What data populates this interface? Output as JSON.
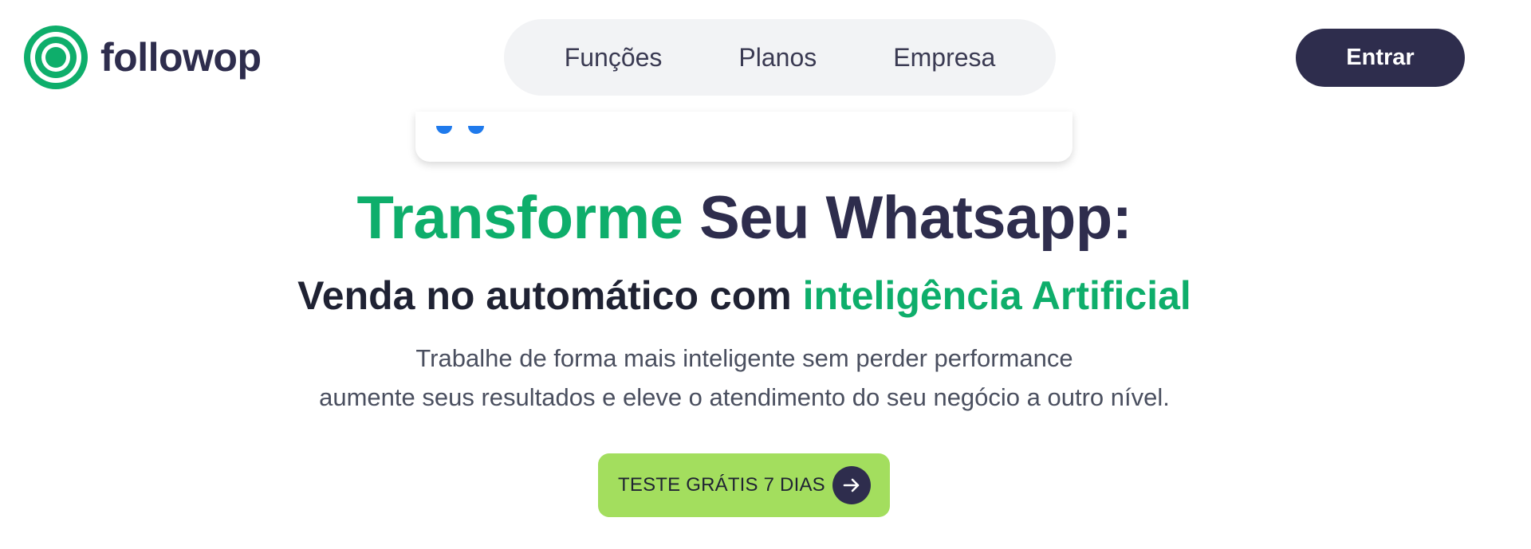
{
  "brand": {
    "name": "followop",
    "logo_icon": "concentric-circles-icon",
    "color": "#0eae6b"
  },
  "nav": {
    "items": [
      {
        "label": "Funções"
      },
      {
        "label": "Planos"
      },
      {
        "label": "Empresa"
      }
    ]
  },
  "header": {
    "enter_label": "Entrar"
  },
  "hero": {
    "title_highlight": "Transforme",
    "title_rest": "Seu Whatsapp:",
    "subtitle_main": "Venda no automático com",
    "subtitle_highlight": "inteligência Artificial",
    "description_line1": "Trabalhe de forma mais inteligente sem perder performance",
    "description_line2": "aumente seus resultados e eleve o atendimento do seu negócio a outro nível.",
    "cta_label": "TESTE GRÁTIS 7 DIAS",
    "cta_icon": "arrow-right-icon"
  },
  "colors": {
    "accent_green": "#0eae6b",
    "dark_navy": "#2e2d4d",
    "cta_green": "#a3de5e",
    "nav_bg": "#f2f3f5"
  }
}
